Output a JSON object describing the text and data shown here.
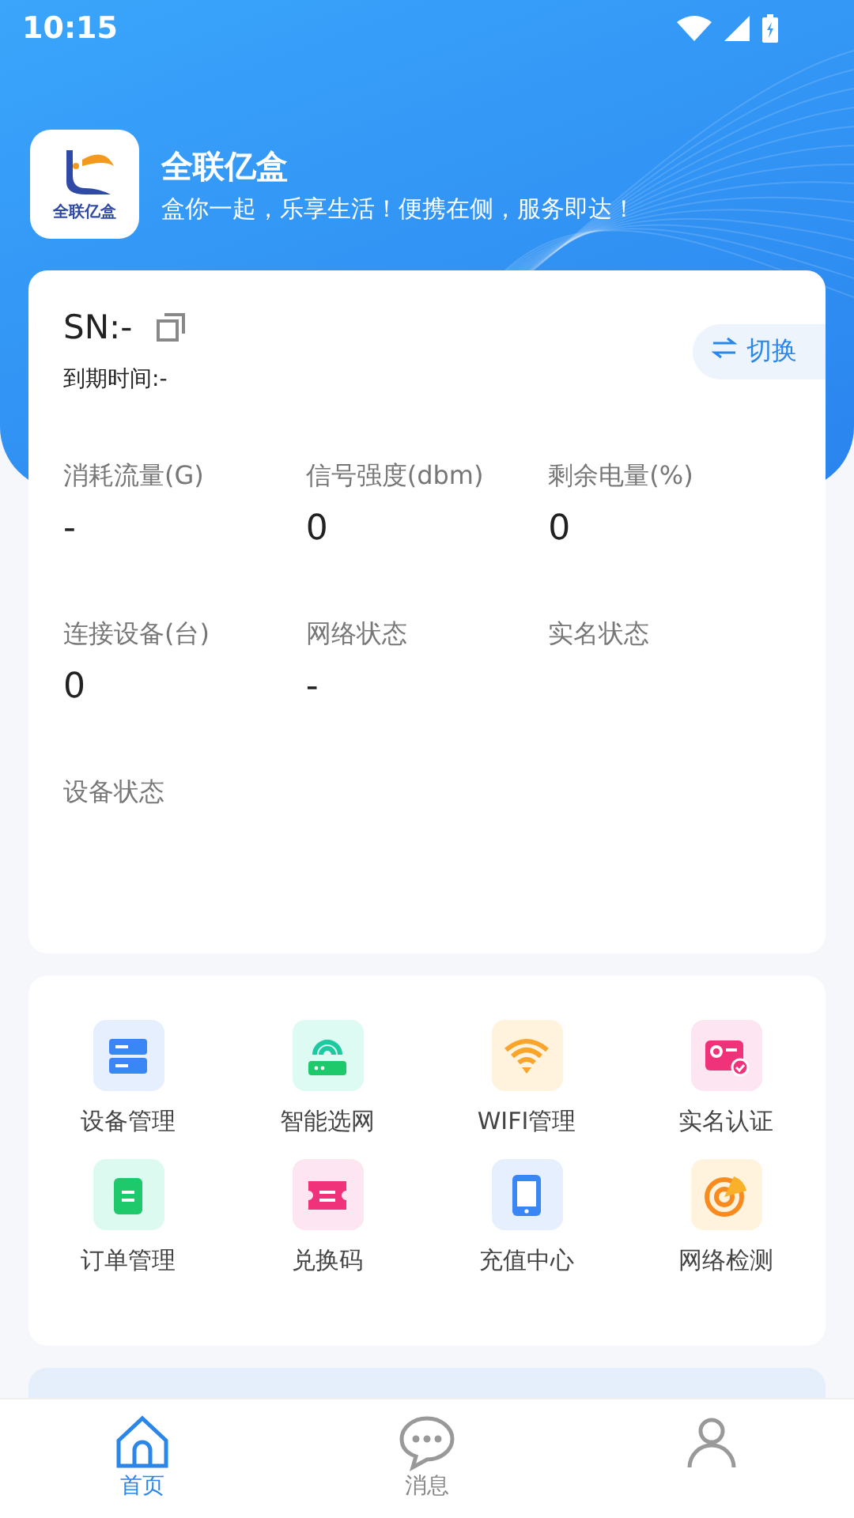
{
  "status_bar": {
    "time": "10:15"
  },
  "header": {
    "logo_text": "全联亿盒",
    "title": "全联亿盒",
    "slogan": "盒你一起，乐享生活！便携在侧，服务即达！"
  },
  "device": {
    "sn": "SN:-",
    "expiry": "到期时间:-",
    "switch_label": "切换",
    "stats": [
      {
        "label": "消耗流量(G)",
        "value": "-"
      },
      {
        "label": "信号强度(dbm)",
        "value": "0"
      },
      {
        "label": "剩余电量(%)",
        "value": "0"
      },
      {
        "label": "连接设备(台)",
        "value": "0"
      },
      {
        "label": "网络状态",
        "value": "-"
      },
      {
        "label": "实名状态"
      },
      {
        "label": "设备状态"
      }
    ]
  },
  "functions": [
    {
      "label": "设备管理",
      "kind": "device",
      "color": "#3a86f5"
    },
    {
      "label": "智能选网",
      "kind": "router",
      "color": "#1ec96b"
    },
    {
      "label": "WIFI管理",
      "kind": "wifi",
      "color": "#f9a42a"
    },
    {
      "label": "实名认证",
      "kind": "idcard",
      "color": "#f0327a"
    },
    {
      "label": "订单管理",
      "kind": "clipboard",
      "color": "#1ec96b"
    },
    {
      "label": "兑换码",
      "kind": "ticket",
      "color": "#f0327a"
    },
    {
      "label": "充值中心",
      "kind": "phone",
      "color": "#3a86f5"
    },
    {
      "label": "网络检测",
      "kind": "radar",
      "color": "#f98a1e"
    }
  ],
  "tabs": [
    {
      "label": "首页",
      "kind": "home",
      "selected": true
    },
    {
      "label": "消息",
      "kind": "message",
      "selected": false
    },
    {
      "kind": "profile",
      "selected": false
    }
  ]
}
